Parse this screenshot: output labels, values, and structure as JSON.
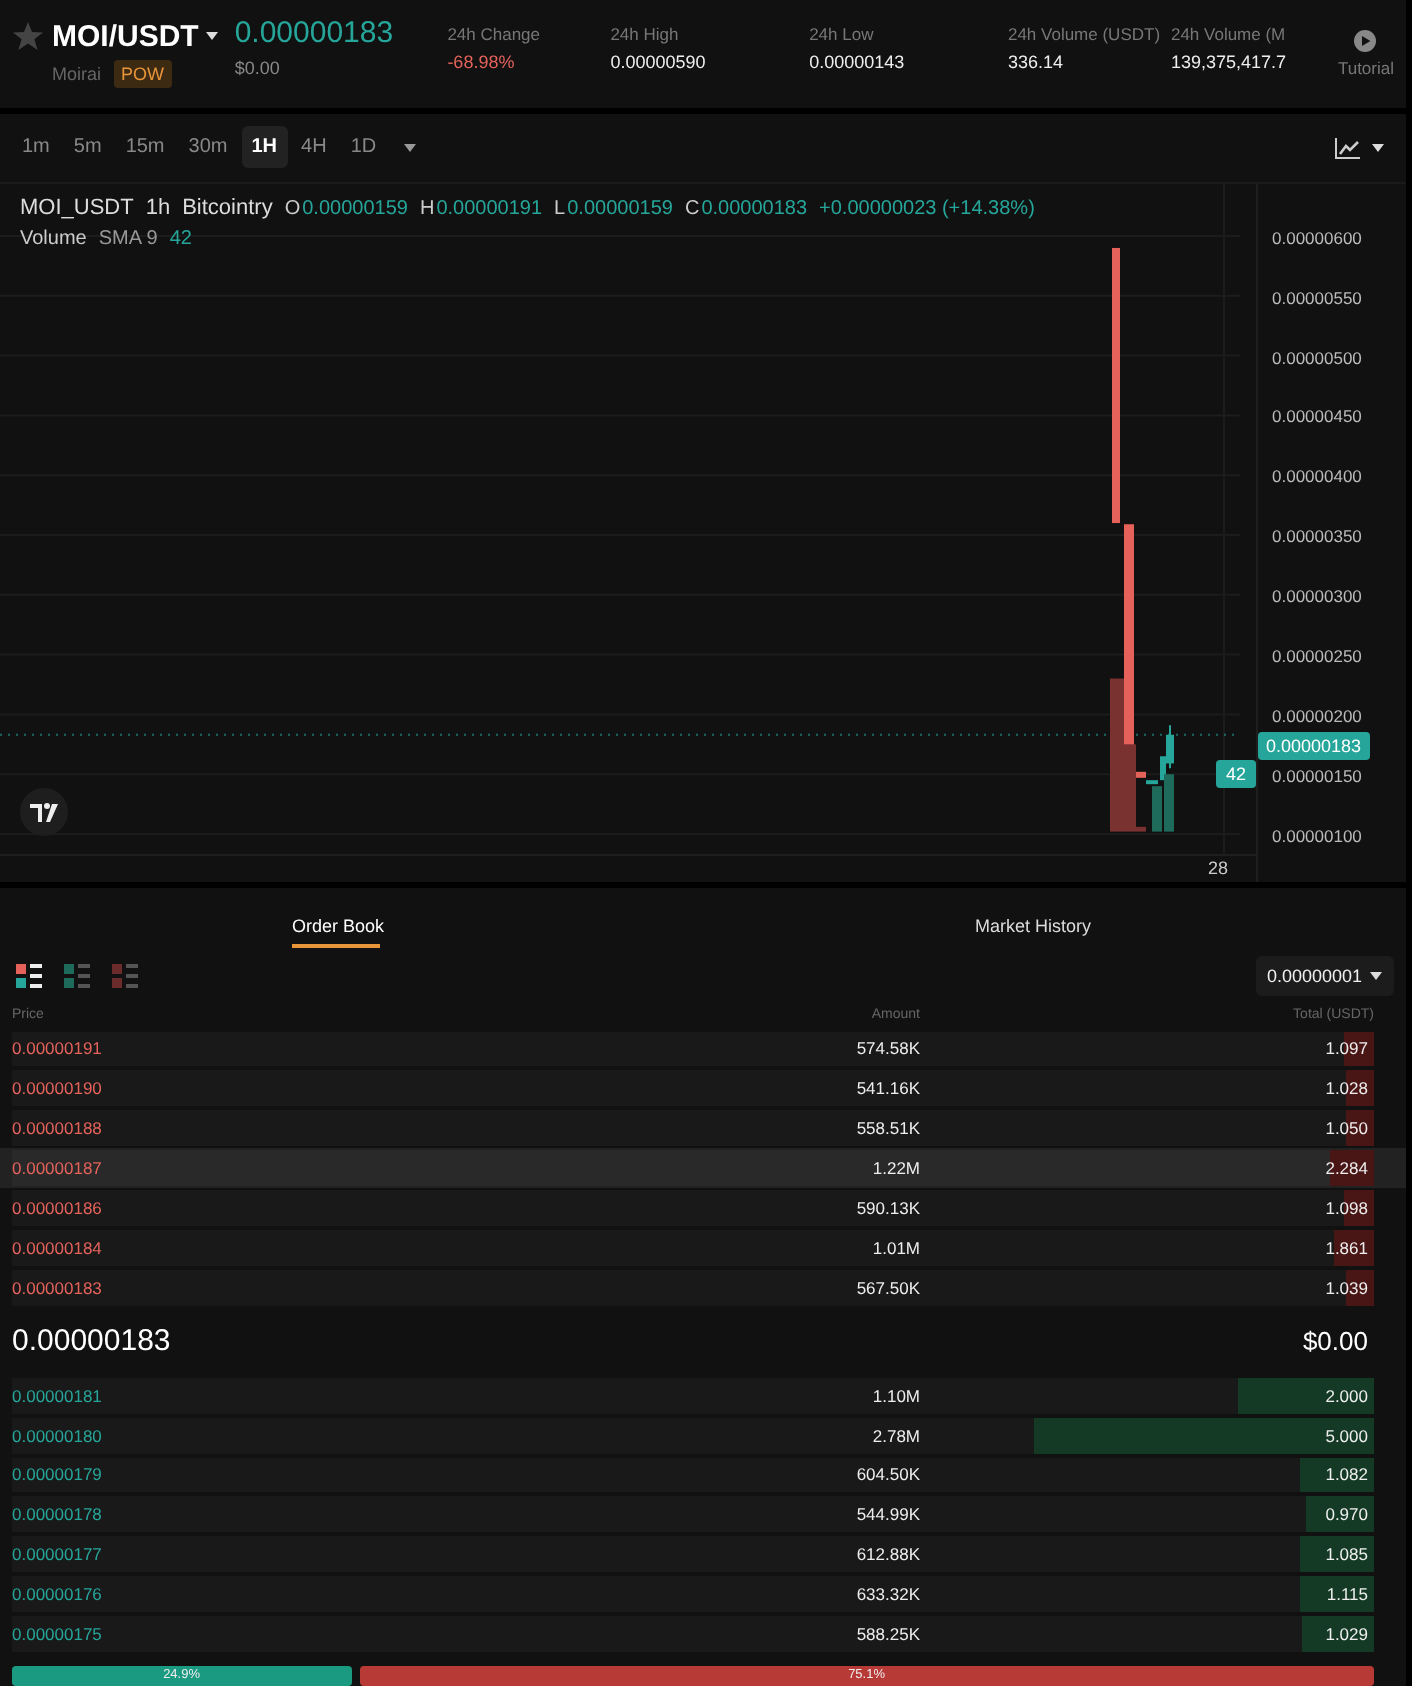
{
  "header": {
    "pair": "MOI/USDT",
    "name": "Moirai",
    "tag": "POW",
    "price": "0.00000183",
    "price_usd": "$0.00",
    "stats": [
      {
        "label": "24h Change",
        "value": "-68.98%",
        "kind": "down"
      },
      {
        "label": "24h High",
        "value": "0.00000590",
        "kind": "plain"
      },
      {
        "label": "24h Low",
        "value": "0.00000143",
        "kind": "plain"
      },
      {
        "label": "24h Volume (USDT)",
        "value": "336.14",
        "kind": "plain"
      },
      {
        "label": "24h Volume (M",
        "value": "139,375,417.7",
        "kind": "plain"
      }
    ],
    "tutorial": "Tutorial"
  },
  "chart": {
    "intervals": [
      {
        "label": "1m",
        "selected": false
      },
      {
        "label": "5m",
        "selected": false
      },
      {
        "label": "15m",
        "selected": false
      },
      {
        "label": "30m",
        "selected": false
      },
      {
        "label": "1H",
        "selected": true
      },
      {
        "label": "4H",
        "selected": false
      },
      {
        "label": "1D",
        "selected": false
      }
    ],
    "legend": {
      "symbol": "MOI_USDT",
      "interval": "1h",
      "exchange": "Bitcointry",
      "ohlc": [
        {
          "label": "O",
          "value": "0.00000159"
        },
        {
          "label": "H",
          "value": "0.00000191"
        },
        {
          "label": "L",
          "value": "0.00000159"
        },
        {
          "label": "C",
          "value": "0.00000183"
        }
      ],
      "change": "+0.00000023 (+14.38%)",
      "volume_label": "Volume",
      "sma": "SMA 9",
      "volume_value": "42"
    },
    "y_ticks": [
      "0.00000600",
      "0.00000550",
      "0.00000500",
      "0.00000450",
      "0.00000400",
      "0.00000350",
      "0.00000300",
      "0.00000250",
      "0.00000200",
      "0.00000150",
      "0.00000100"
    ],
    "price_badge": "0.00000183",
    "volume_badge": "42",
    "x_tick": "28"
  },
  "order_book": {
    "tabs": [
      {
        "label": "Order Book",
        "selected": true
      },
      {
        "label": "Market History",
        "selected": false
      }
    ],
    "views": [
      {
        "kind": "both",
        "selected": true
      },
      {
        "kind": "bids",
        "selected": false
      },
      {
        "kind": "asks",
        "selected": false
      }
    ],
    "precision": "0.00000001",
    "columns": [
      "Price",
      "Amount",
      "Total (USDT)"
    ],
    "asks": [
      {
        "price": "0.00000191",
        "amount": "574.58K",
        "total": "1.097",
        "level": 0.022,
        "highlighted": false
      },
      {
        "price": "0.00000190",
        "amount": "541.16K",
        "total": "1.028",
        "level": 0.02,
        "highlighted": false
      },
      {
        "price": "0.00000188",
        "amount": "558.51K",
        "total": "1.050",
        "level": 0.02,
        "highlighted": false
      },
      {
        "price": "0.00000187",
        "amount": "1.22M",
        "total": "2.284",
        "level": 0.032,
        "highlighted": true
      },
      {
        "price": "0.00000186",
        "amount": "590.13K",
        "total": "1.098",
        "level": 0.022,
        "highlighted": false
      },
      {
        "price": "0.00000184",
        "amount": "1.01M",
        "total": "1.861",
        "level": 0.03,
        "highlighted": false
      },
      {
        "price": "0.00000183",
        "amount": "567.50K",
        "total": "1.039",
        "level": 0.02,
        "highlighted": false
      }
    ],
    "mid_price": "0.00000183",
    "mid_usd": "$0.00",
    "bids": [
      {
        "price": "0.00000181",
        "amount": "1.10M",
        "total": "2.000",
        "level": 0.1
      },
      {
        "price": "0.00000180",
        "amount": "2.78M",
        "total": "5.000",
        "level": 0.25
      },
      {
        "price": "0.00000179",
        "amount": "604.50K",
        "total": "1.082",
        "level": 0.055
      },
      {
        "price": "0.00000178",
        "amount": "544.99K",
        "total": "0.970",
        "level": 0.05
      },
      {
        "price": "0.00000177",
        "amount": "612.88K",
        "total": "1.085",
        "level": 0.055
      },
      {
        "price": "0.00000176",
        "amount": "633.32K",
        "total": "1.115",
        "level": 0.055
      },
      {
        "price": "0.00000175",
        "amount": "588.25K",
        "total": "1.029",
        "level": 0.053
      }
    ],
    "ratio": {
      "buy_label": "24.9%",
      "sell_label": "75.1%",
      "level": 0.249
    }
  }
}
